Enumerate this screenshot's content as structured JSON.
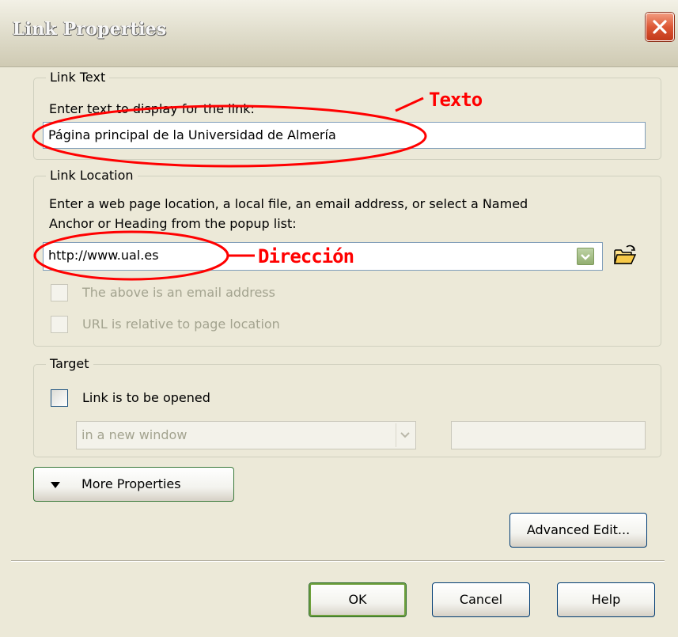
{
  "window": {
    "title": "Link Properties",
    "close_label": "×"
  },
  "link_text": {
    "group_label": "Link Text",
    "instruction": "Enter text to display for the link:",
    "value": "Página principal de la Universidad de Almería",
    "annotation": "Texto"
  },
  "link_location": {
    "group_label": "Link Location",
    "instruction_line1": "Enter a web page location, a local file, an email address, or select a Named",
    "instruction_line2": "Anchor or Heading from the popup list:",
    "value": "http://www.ual.es",
    "annotation": "Dirección",
    "checkbox_email_label": "The above is an email address",
    "checkbox_relative_label": "URL is relative to page location"
  },
  "target": {
    "group_label": "Target",
    "checkbox_label": "Link is to be opened",
    "select_value": "in a new window",
    "frame_input": ""
  },
  "buttons": {
    "more_properties": "More Properties",
    "advanced_edit": "Advanced Edit...",
    "ok": "OK",
    "cancel": "Cancel",
    "help": "Help"
  },
  "colors": {
    "annotation_red": "#ff0000",
    "dialog_bg": "#ece9d8",
    "titlebar_text": "#f7f7f7",
    "close_red": "#dd5836"
  },
  "icons": {
    "close": "close-icon",
    "combo_dropdown": "chevron-down-icon",
    "browse": "folder-open-icon",
    "more_properties": "triangle-down-icon"
  }
}
